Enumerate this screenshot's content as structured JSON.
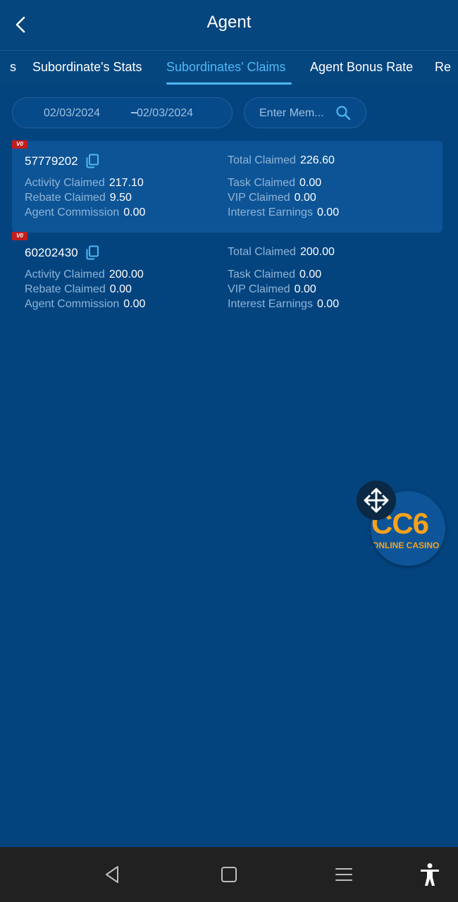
{
  "header": {
    "title": "Agent"
  },
  "tabs": [
    {
      "label": "s"
    },
    {
      "label": "Subordinate's Stats"
    },
    {
      "label": "Subordinates' Claims"
    },
    {
      "label": "Agent Bonus Rate"
    },
    {
      "label": "Re"
    }
  ],
  "active_tab": "Subordinates' Claims",
  "filters": {
    "date_from": "02/03/2024",
    "date_to": "02/03/2024",
    "search_placeholder": "Enter Mem..."
  },
  "records": [
    {
      "vip": "V0",
      "member_id": "57779202",
      "total_claimed_label": "Total Claimed",
      "total_claimed": "226.60",
      "activity_claimed_label": "Activity Claimed",
      "activity_claimed": "217.10",
      "task_claimed_label": "Task Claimed",
      "task_claimed": "0.00",
      "rebate_claimed_label": "Rebate Claimed",
      "rebate_claimed": "9.50",
      "vip_claimed_label": "VIP Claimed",
      "vip_claimed": "0.00",
      "agent_commission_label": "Agent Commission",
      "agent_commission": "0.00",
      "interest_earnings_label": "Interest Earnings",
      "interest_earnings": "0.00"
    },
    {
      "vip": "V0",
      "member_id": "60202430",
      "total_claimed_label": "Total Claimed",
      "total_claimed": "200.00",
      "activity_claimed_label": "Activity Claimed",
      "activity_claimed": "200.00",
      "task_claimed_label": "Task Claimed",
      "task_claimed": "0.00",
      "rebate_claimed_label": "Rebate Claimed",
      "rebate_claimed": "0.00",
      "vip_claimed_label": "VIP Claimed",
      "vip_claimed": "0.00",
      "agent_commission_label": "Agent Commission",
      "agent_commission": "0.00",
      "interest_earnings_label": "Interest Earnings",
      "interest_earnings": "0.00"
    }
  ],
  "floating_widget": {
    "logo_text": "CC6",
    "logo_subtext": "ONLINE CASINO",
    "move_icon": "move-arrows-icon"
  },
  "navbar": {
    "icons": [
      "back-triangle-icon",
      "home-square-icon",
      "menu-lines-icon",
      "accessibility-icon"
    ]
  },
  "colors": {
    "background": "#03447f",
    "accent": "#4fb7f3",
    "label_text": "#8fb4d7",
    "vip_badge": "#c41d1d",
    "logo": "#f7a21b",
    "navbar": "#212121"
  }
}
